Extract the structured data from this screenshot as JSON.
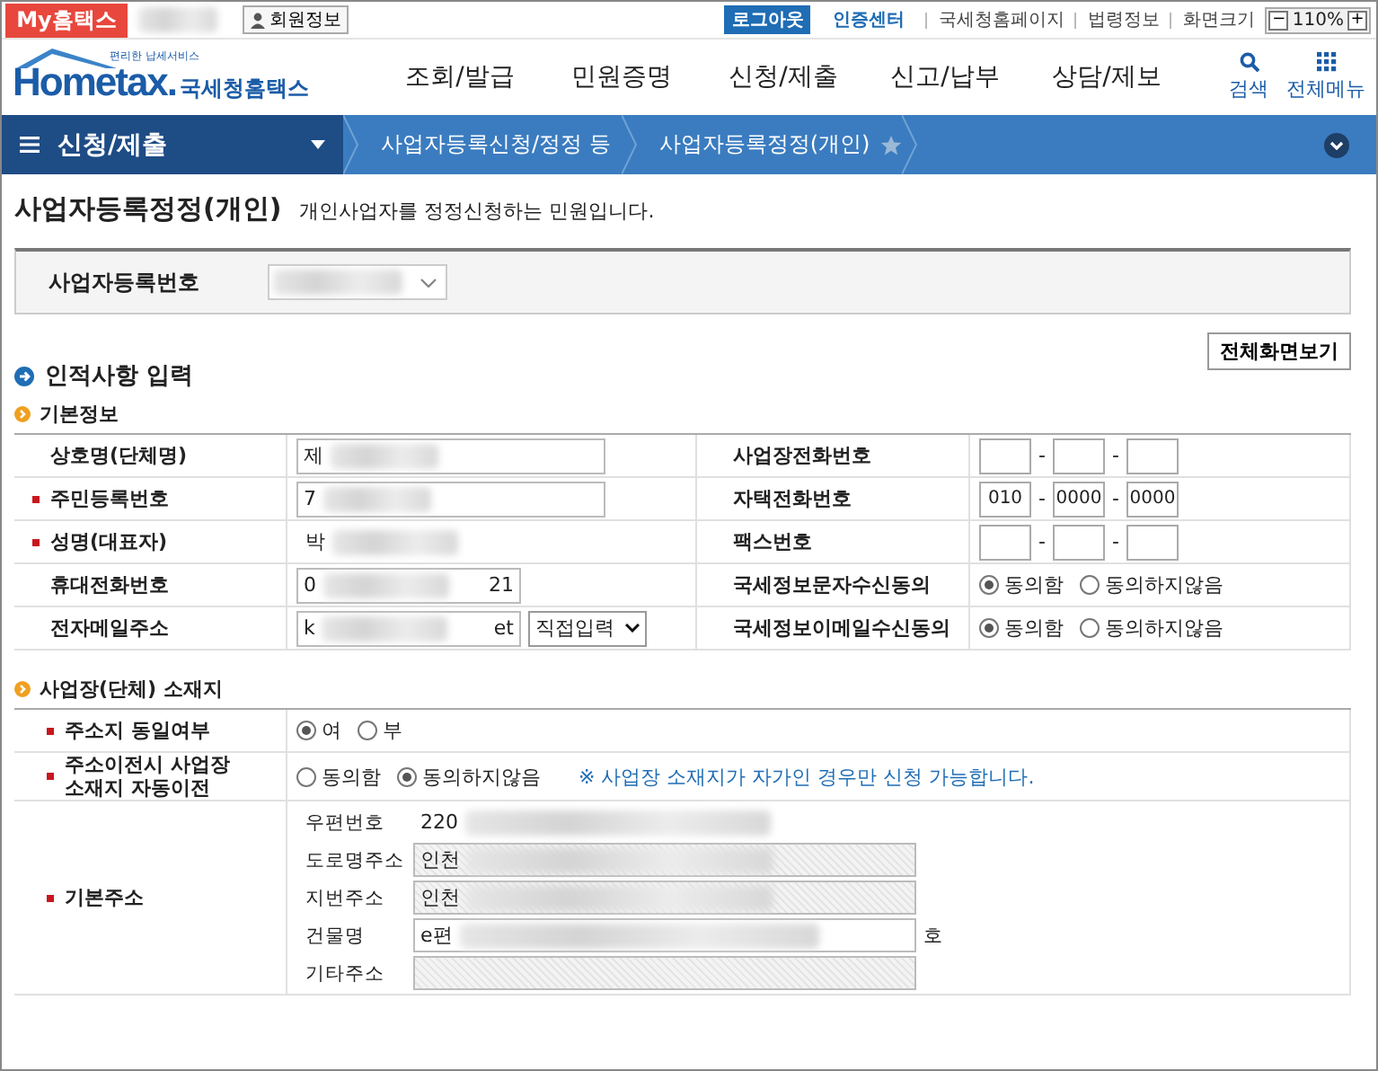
{
  "top_bar": {
    "my_hometax": "My홈택스",
    "member_info": "회원정보",
    "logout": "로그아웃",
    "cert_center": "인증센터",
    "links": [
      "국세청홈페이지",
      "법령정보"
    ],
    "zoom_label": "화면크기",
    "zoom_minus": "−",
    "zoom_value": "110%",
    "zoom_plus": "+"
  },
  "header": {
    "tagline": "편리한 납세서비스",
    "logo_text": "Hometax.",
    "logo_korean": "국세청홈택스",
    "menu": [
      "조회/발급",
      "민원증명",
      "신청/제출",
      "신고/납부",
      "상담/제보"
    ],
    "search": "검색",
    "all_menu": "전체메뉴"
  },
  "nav": {
    "current": "신청/제출",
    "breadcrumbs": [
      "사업자등록신청/정정 등",
      "사업자등록정정(개인)"
    ]
  },
  "page": {
    "title": "사업자등록정정(개인)",
    "subtitle": "개인사업자를 정정신청하는 민원입니다.",
    "business_number_label": "사업자등록번호",
    "full_screen_button": "전체화면보기",
    "section_title": "인적사항 입력"
  },
  "basic_info": {
    "title": "기본정보",
    "rows": [
      {
        "left": {
          "label": "상호명(단체명)",
          "required": false,
          "kind": "text",
          "value": "제"
        },
        "right": {
          "label": "사업장전화번호",
          "required": false,
          "kind": "phone",
          "separators": [
            "-",
            "-"
          ]
        }
      },
      {
        "left": {
          "label": "주민등록번호",
          "required": true,
          "kind": "text",
          "value": "7"
        },
        "right": {
          "label": "자택전화번호",
          "required": false,
          "kind": "phone",
          "values": [
            "010",
            "0000",
            "0000"
          ],
          "separators": [
            "-",
            "-"
          ]
        }
      },
      {
        "left": {
          "label": "성명(대표자)",
          "required": true,
          "kind": "plain",
          "value": "박"
        },
        "right": {
          "label": "팩스번호",
          "required": false,
          "kind": "phone",
          "separators": [
            "-",
            "-"
          ]
        }
      },
      {
        "left": {
          "label": "휴대전화번호",
          "required": false,
          "kind": "text",
          "value": "0",
          "tail": "21"
        },
        "right": {
          "label": "국세정보문자수신동의",
          "required": false,
          "kind": "radio",
          "options": [
            {
              "label": "동의함",
              "selected": true
            },
            {
              "label": "동의하지않음",
              "selected": false
            }
          ]
        }
      },
      {
        "left": {
          "label": "전자메일주소",
          "required": false,
          "kind": "email",
          "value": "k",
          "tail": "et",
          "select": "직접입력"
        },
        "right": {
          "label": "국세정보이메일수신동의",
          "required": false,
          "kind": "radio",
          "options": [
            {
              "label": "동의함",
              "selected": true
            },
            {
              "label": "동의하지않음",
              "selected": false
            }
          ]
        }
      }
    ]
  },
  "location": {
    "title": "사업장(단체) 소재지",
    "rows": [
      {
        "label": "주소지 동일여부",
        "required": true,
        "kind": "radio",
        "options": [
          {
            "label": "여",
            "selected": true
          },
          {
            "label": "부",
            "selected": false
          }
        ]
      },
      {
        "label": "주소이전시 사업장 소재지 자동이전",
        "required": true,
        "kind": "radio",
        "options": [
          {
            "label": "동의함",
            "selected": false
          },
          {
            "label": "동의하지않음",
            "selected": true
          }
        ],
        "note": "※ 사업장 소재지가 자가인 경우만 신청 가능합니다."
      },
      {
        "label": "기본주소",
        "required": true,
        "kind": "address",
        "fields": [
          {
            "label": "우편번호",
            "value": "220",
            "disabled": false,
            "boxed": false
          },
          {
            "label": "도로명주소",
            "value": "인천",
            "disabled": true,
            "boxed": true
          },
          {
            "label": "지번주소",
            "value": "인천",
            "disabled": true,
            "boxed": true
          },
          {
            "label": "건물명",
            "value": "e편",
            "disabled": false,
            "boxed": true,
            "suffix": "호"
          },
          {
            "label": "기타주소",
            "disabled": true,
            "boxed": true
          }
        ]
      }
    ]
  }
}
